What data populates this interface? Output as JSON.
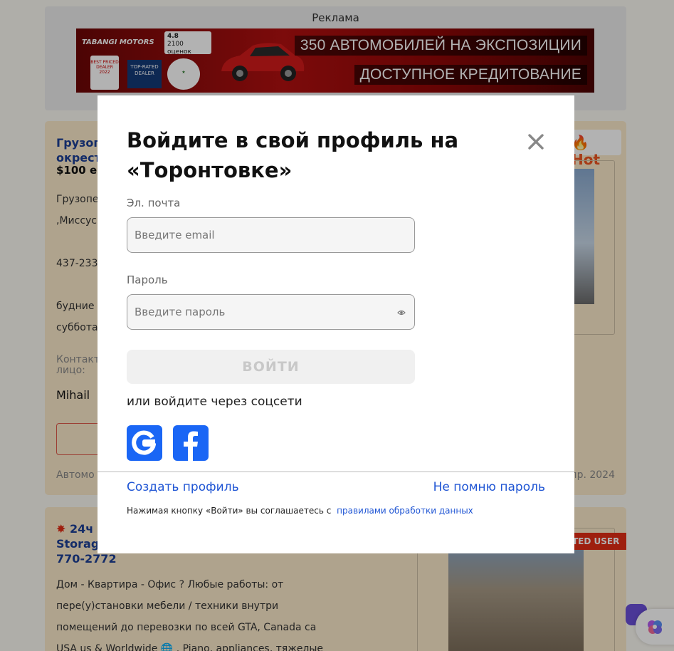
{
  "ad": {
    "label": "Реклама",
    "logo_text": "TABANGI MOTORS",
    "google_rating": "4.8",
    "google_reviews": "2100 оценок",
    "badge_text": "BEST PRICED DEALER 2022",
    "dealer_badge": "TOP-RATED DEALER",
    "headline_1": "350 АВТОМОБИЛЕЙ НА ЭКСПОЗИЦИИ",
    "headline_2": "ДОСТУПНОЕ КРЕДИТОВАНИЕ"
  },
  "listing_1": {
    "title_line_1": "Грузоп",
    "title_line_2": "окрест",
    "price": "$100 ед",
    "line_1": "Грузопе",
    "line_2": ",Миссус",
    "phone": "437-233-",
    "days_1": "будние",
    "days_2": "суббота",
    "contact_label": "Контакт",
    "contact_label_2": "лицо:",
    "contact_name": "Mihail",
    "hot_label": "Hot",
    "category_fragment": "Автомо",
    "date_fragment": "пр. 2024"
  },
  "listing_2": {
    "title_line_1": "24ч",
    "title_line_2": "Storage",
    "title_line_3": "770-2772",
    "badge": "TED USER",
    "desc_1": "Дом - Квартира - Офис ? Любые работы: от",
    "desc_2": "пере(у)становки мебели / техники внутри",
    "desc_3": "помещений до перевозки по всей GTA, Canada ca",
    "desc_4": "USA us & Worldwide 🌐 . Piano, appliances, тяжелые"
  },
  "login_modal": {
    "title": "Войдите в свой профиль на «Торонтовке»",
    "email_label": "Эл. почта",
    "email_placeholder": "Введите email",
    "password_label": "Пароль",
    "password_placeholder": "Введите пароль",
    "submit_label": "ВОЙТИ",
    "social_prompt": "или войдите через соцсети",
    "create_profile": "Создать профиль",
    "forgot_password": "Не помню пароль",
    "agree_text": "Нажимая кнопку «Войти» вы соглашаетесь с",
    "agree_link": "правилами обработки данных"
  },
  "colors": {
    "link": "#1f55d4",
    "social_button": "#1a66f5",
    "submit_disabled_bg": "#f0f0f0",
    "hot": "#ee5522",
    "badge_red": "#e22d15"
  },
  "icons": [
    "close-icon",
    "eye-icon",
    "google-icon",
    "facebook-icon",
    "brain-icon",
    "fire-icon"
  ]
}
